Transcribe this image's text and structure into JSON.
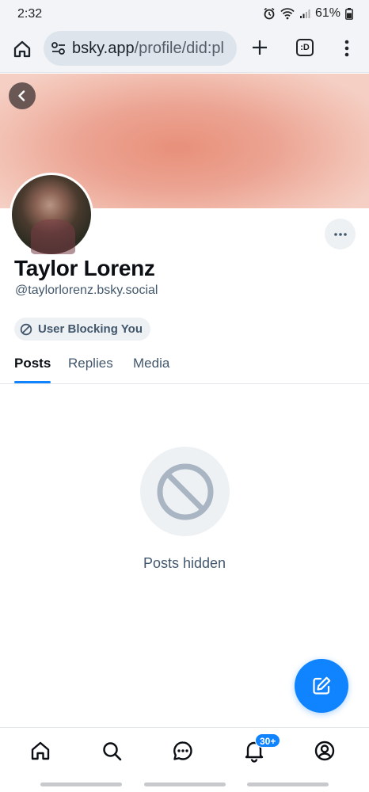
{
  "status_bar": {
    "time": "2:32",
    "battery": "61%"
  },
  "browser": {
    "url_host": "bsky.app",
    "url_path": "/profile/did:pl",
    "tabs_label": ":D"
  },
  "profile": {
    "display_name": "Taylor Lorenz",
    "handle": "@taylorlorenz.bsky.social",
    "block_badge": "User Blocking You"
  },
  "tabs": [
    {
      "label": "Posts",
      "active": true
    },
    {
      "label": "Replies",
      "active": false
    },
    {
      "label": "Media",
      "active": false
    }
  ],
  "empty_state": {
    "label": "Posts hidden"
  },
  "bottom_nav": {
    "notification_badge": "30+"
  },
  "colors": {
    "accent": "#1083fe",
    "muted_text": "#42576c",
    "banner": "#eca493"
  }
}
